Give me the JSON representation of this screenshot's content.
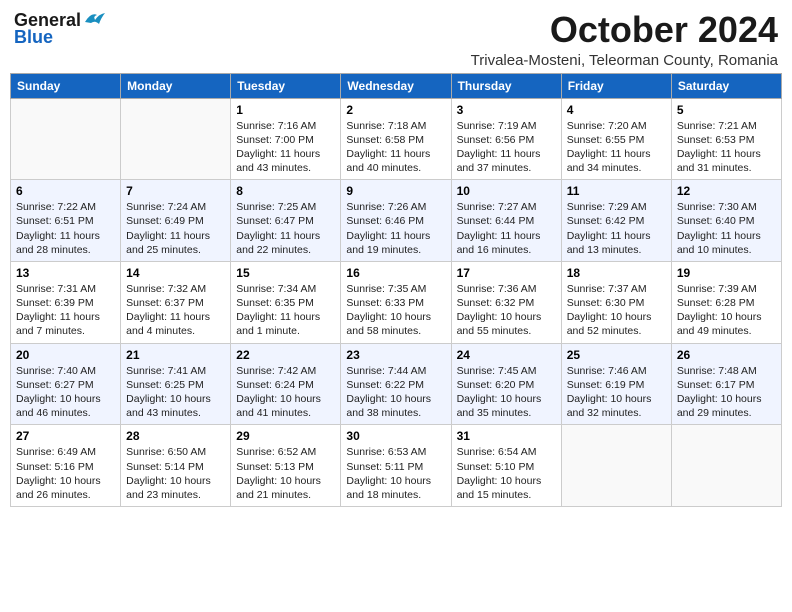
{
  "header": {
    "logo_line1": "General",
    "logo_line2": "Blue",
    "month": "October 2024",
    "subtitle": "Trivalea-Mosteni, Teleorman County, Romania"
  },
  "weekdays": [
    "Sunday",
    "Monday",
    "Tuesday",
    "Wednesday",
    "Thursday",
    "Friday",
    "Saturday"
  ],
  "rows": [
    [
      {
        "day": "",
        "sunrise": "",
        "sunset": "",
        "daylight": ""
      },
      {
        "day": "",
        "sunrise": "",
        "sunset": "",
        "daylight": ""
      },
      {
        "day": "1",
        "sunrise": "Sunrise: 7:16 AM",
        "sunset": "Sunset: 7:00 PM",
        "daylight": "Daylight: 11 hours and 43 minutes."
      },
      {
        "day": "2",
        "sunrise": "Sunrise: 7:18 AM",
        "sunset": "Sunset: 6:58 PM",
        "daylight": "Daylight: 11 hours and 40 minutes."
      },
      {
        "day": "3",
        "sunrise": "Sunrise: 7:19 AM",
        "sunset": "Sunset: 6:56 PM",
        "daylight": "Daylight: 11 hours and 37 minutes."
      },
      {
        "day": "4",
        "sunrise": "Sunrise: 7:20 AM",
        "sunset": "Sunset: 6:55 PM",
        "daylight": "Daylight: 11 hours and 34 minutes."
      },
      {
        "day": "5",
        "sunrise": "Sunrise: 7:21 AM",
        "sunset": "Sunset: 6:53 PM",
        "daylight": "Daylight: 11 hours and 31 minutes."
      }
    ],
    [
      {
        "day": "6",
        "sunrise": "Sunrise: 7:22 AM",
        "sunset": "Sunset: 6:51 PM",
        "daylight": "Daylight: 11 hours and 28 minutes."
      },
      {
        "day": "7",
        "sunrise": "Sunrise: 7:24 AM",
        "sunset": "Sunset: 6:49 PM",
        "daylight": "Daylight: 11 hours and 25 minutes."
      },
      {
        "day": "8",
        "sunrise": "Sunrise: 7:25 AM",
        "sunset": "Sunset: 6:47 PM",
        "daylight": "Daylight: 11 hours and 22 minutes."
      },
      {
        "day": "9",
        "sunrise": "Sunrise: 7:26 AM",
        "sunset": "Sunset: 6:46 PM",
        "daylight": "Daylight: 11 hours and 19 minutes."
      },
      {
        "day": "10",
        "sunrise": "Sunrise: 7:27 AM",
        "sunset": "Sunset: 6:44 PM",
        "daylight": "Daylight: 11 hours and 16 minutes."
      },
      {
        "day": "11",
        "sunrise": "Sunrise: 7:29 AM",
        "sunset": "Sunset: 6:42 PM",
        "daylight": "Daylight: 11 hours and 13 minutes."
      },
      {
        "day": "12",
        "sunrise": "Sunrise: 7:30 AM",
        "sunset": "Sunset: 6:40 PM",
        "daylight": "Daylight: 11 hours and 10 minutes."
      }
    ],
    [
      {
        "day": "13",
        "sunrise": "Sunrise: 7:31 AM",
        "sunset": "Sunset: 6:39 PM",
        "daylight": "Daylight: 11 hours and 7 minutes."
      },
      {
        "day": "14",
        "sunrise": "Sunrise: 7:32 AM",
        "sunset": "Sunset: 6:37 PM",
        "daylight": "Daylight: 11 hours and 4 minutes."
      },
      {
        "day": "15",
        "sunrise": "Sunrise: 7:34 AM",
        "sunset": "Sunset: 6:35 PM",
        "daylight": "Daylight: 11 hours and 1 minute."
      },
      {
        "day": "16",
        "sunrise": "Sunrise: 7:35 AM",
        "sunset": "Sunset: 6:33 PM",
        "daylight": "Daylight: 10 hours and 58 minutes."
      },
      {
        "day": "17",
        "sunrise": "Sunrise: 7:36 AM",
        "sunset": "Sunset: 6:32 PM",
        "daylight": "Daylight: 10 hours and 55 minutes."
      },
      {
        "day": "18",
        "sunrise": "Sunrise: 7:37 AM",
        "sunset": "Sunset: 6:30 PM",
        "daylight": "Daylight: 10 hours and 52 minutes."
      },
      {
        "day": "19",
        "sunrise": "Sunrise: 7:39 AM",
        "sunset": "Sunset: 6:28 PM",
        "daylight": "Daylight: 10 hours and 49 minutes."
      }
    ],
    [
      {
        "day": "20",
        "sunrise": "Sunrise: 7:40 AM",
        "sunset": "Sunset: 6:27 PM",
        "daylight": "Daylight: 10 hours and 46 minutes."
      },
      {
        "day": "21",
        "sunrise": "Sunrise: 7:41 AM",
        "sunset": "Sunset: 6:25 PM",
        "daylight": "Daylight: 10 hours and 43 minutes."
      },
      {
        "day": "22",
        "sunrise": "Sunrise: 7:42 AM",
        "sunset": "Sunset: 6:24 PM",
        "daylight": "Daylight: 10 hours and 41 minutes."
      },
      {
        "day": "23",
        "sunrise": "Sunrise: 7:44 AM",
        "sunset": "Sunset: 6:22 PM",
        "daylight": "Daylight: 10 hours and 38 minutes."
      },
      {
        "day": "24",
        "sunrise": "Sunrise: 7:45 AM",
        "sunset": "Sunset: 6:20 PM",
        "daylight": "Daylight: 10 hours and 35 minutes."
      },
      {
        "day": "25",
        "sunrise": "Sunrise: 7:46 AM",
        "sunset": "Sunset: 6:19 PM",
        "daylight": "Daylight: 10 hours and 32 minutes."
      },
      {
        "day": "26",
        "sunrise": "Sunrise: 7:48 AM",
        "sunset": "Sunset: 6:17 PM",
        "daylight": "Daylight: 10 hours and 29 minutes."
      }
    ],
    [
      {
        "day": "27",
        "sunrise": "Sunrise: 6:49 AM",
        "sunset": "Sunset: 5:16 PM",
        "daylight": "Daylight: 10 hours and 26 minutes."
      },
      {
        "day": "28",
        "sunrise": "Sunrise: 6:50 AM",
        "sunset": "Sunset: 5:14 PM",
        "daylight": "Daylight: 10 hours and 23 minutes."
      },
      {
        "day": "29",
        "sunrise": "Sunrise: 6:52 AM",
        "sunset": "Sunset: 5:13 PM",
        "daylight": "Daylight: 10 hours and 21 minutes."
      },
      {
        "day": "30",
        "sunrise": "Sunrise: 6:53 AM",
        "sunset": "Sunset: 5:11 PM",
        "daylight": "Daylight: 10 hours and 18 minutes."
      },
      {
        "day": "31",
        "sunrise": "Sunrise: 6:54 AM",
        "sunset": "Sunset: 5:10 PM",
        "daylight": "Daylight: 10 hours and 15 minutes."
      },
      {
        "day": "",
        "sunrise": "",
        "sunset": "",
        "daylight": ""
      },
      {
        "day": "",
        "sunrise": "",
        "sunset": "",
        "daylight": ""
      }
    ]
  ]
}
